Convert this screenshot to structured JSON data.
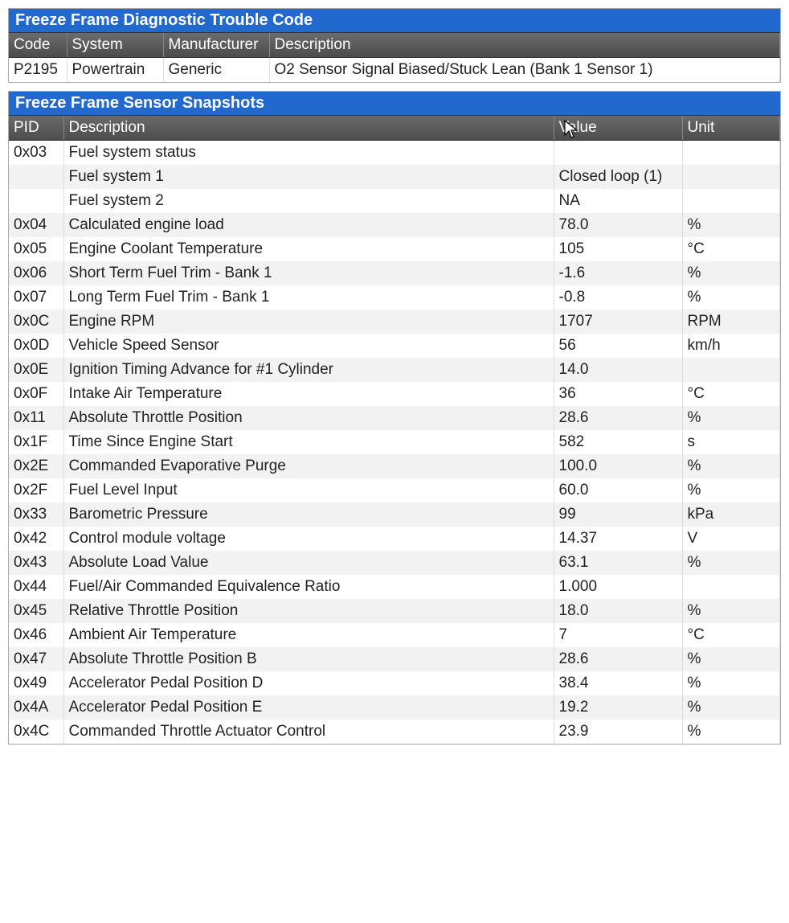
{
  "dtc_panel": {
    "title": "Freeze Frame Diagnostic Trouble Code",
    "headers": [
      "Code",
      "System",
      "Manufacturer",
      "Description"
    ],
    "row": {
      "code": "P2195",
      "system": "Powertrain",
      "manufacturer": "Generic",
      "description": "O2 Sensor Signal Biased/Stuck Lean (Bank 1 Sensor 1)"
    }
  },
  "sensor_panel": {
    "title": "Freeze Frame Sensor Snapshots",
    "headers": [
      "PID",
      "Description",
      "Value",
      "Unit"
    ],
    "rows": [
      {
        "pid": "0x03",
        "desc": "Fuel system status",
        "value": "",
        "unit": ""
      },
      {
        "pid": "",
        "desc": "Fuel system 1",
        "value": "Closed loop (1)",
        "unit": ""
      },
      {
        "pid": "",
        "desc": "Fuel system 2",
        "value": "NA",
        "unit": ""
      },
      {
        "pid": "0x04",
        "desc": "Calculated engine load",
        "value": "78.0",
        "unit": "%"
      },
      {
        "pid": "0x05",
        "desc": "Engine Coolant Temperature",
        "value": "105",
        "unit": "°C"
      },
      {
        "pid": "0x06",
        "desc": "Short Term Fuel Trim - Bank 1",
        "value": "-1.6",
        "unit": "%"
      },
      {
        "pid": "0x07",
        "desc": "Long Term Fuel Trim - Bank 1",
        "value": "-0.8",
        "unit": "%"
      },
      {
        "pid": "0x0C",
        "desc": "Engine RPM",
        "value": "1707",
        "unit": "RPM"
      },
      {
        "pid": "0x0D",
        "desc": "Vehicle Speed Sensor",
        "value": "56",
        "unit": "km/h"
      },
      {
        "pid": "0x0E",
        "desc": "Ignition Timing Advance for #1 Cylinder",
        "value": "14.0",
        "unit": ""
      },
      {
        "pid": "0x0F",
        "desc": "Intake Air Temperature",
        "value": "36",
        "unit": "°C"
      },
      {
        "pid": "0x11",
        "desc": "Absolute Throttle Position",
        "value": "28.6",
        "unit": "%"
      },
      {
        "pid": "0x1F",
        "desc": "Time Since Engine Start",
        "value": "582",
        "unit": "s"
      },
      {
        "pid": "0x2E",
        "desc": "Commanded Evaporative Purge",
        "value": "100.0",
        "unit": "%"
      },
      {
        "pid": "0x2F",
        "desc": "Fuel Level Input",
        "value": "60.0",
        "unit": "%"
      },
      {
        "pid": "0x33",
        "desc": "Barometric Pressure",
        "value": "99",
        "unit": "kPa"
      },
      {
        "pid": "0x42",
        "desc": "Control module voltage",
        "value": "14.37",
        "unit": "V"
      },
      {
        "pid": "0x43",
        "desc": "Absolute Load Value",
        "value": "63.1",
        "unit": "%"
      },
      {
        "pid": "0x44",
        "desc": "Fuel/Air Commanded Equivalence Ratio",
        "value": "1.000",
        "unit": ""
      },
      {
        "pid": "0x45",
        "desc": "Relative Throttle Position",
        "value": "18.0",
        "unit": "%"
      },
      {
        "pid": "0x46",
        "desc": "Ambient Air Temperature",
        "value": "7",
        "unit": "°C"
      },
      {
        "pid": "0x47",
        "desc": "Absolute Throttle Position B",
        "value": "28.6",
        "unit": "%"
      },
      {
        "pid": "0x49",
        "desc": "Accelerator Pedal Position D",
        "value": "38.4",
        "unit": "%"
      },
      {
        "pid": "0x4A",
        "desc": "Accelerator Pedal Position E",
        "value": "19.2",
        "unit": "%"
      },
      {
        "pid": "0x4C",
        "desc": "Commanded Throttle Actuator Control",
        "value": "23.9",
        "unit": "%"
      }
    ]
  }
}
